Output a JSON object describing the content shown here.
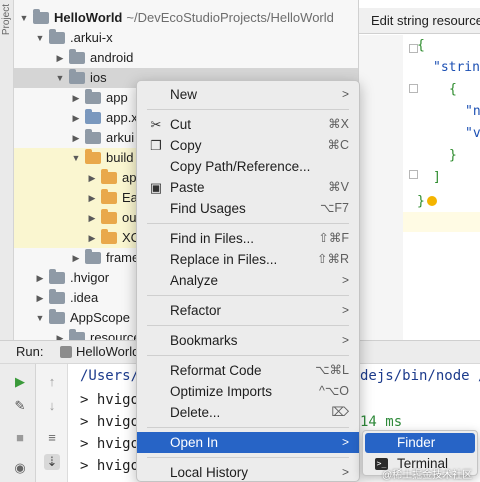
{
  "gutter_label": "Project",
  "tree": {
    "root_name": "HelloWorld",
    "root_path": "~/DevEcoStudioProjects/HelloWorld",
    "items": [
      {
        "label": "HelloWorld"
      },
      {
        "label": ".arkui-x"
      },
      {
        "label": "android"
      },
      {
        "label": "ios"
      },
      {
        "label": "app"
      },
      {
        "label": "app.x"
      },
      {
        "label": "arkui"
      },
      {
        "label": "build"
      },
      {
        "label": "ap"
      },
      {
        "label": "Ea"
      },
      {
        "label": "ou"
      },
      {
        "label": "XC"
      },
      {
        "label": "frame"
      },
      {
        "label": ".hvigor"
      },
      {
        "label": ".idea"
      },
      {
        "label": "AppScope"
      },
      {
        "label": "resources"
      }
    ]
  },
  "editor": {
    "tab_title": "Edit string resources",
    "line_1": "{",
    "line_2": "\"strin",
    "line_3": "{",
    "line_4": "\"n",
    "line_5": "\"v",
    "line_6": "}",
    "line_7": "]",
    "line_8": "}"
  },
  "run": {
    "label": "Run:",
    "tab": "HelloWorld"
  },
  "console": {
    "line_1": "/Users/",
    "line_1_tail": "dejs/bin/node /",
    "line_2": "> hvigo",
    "line_3": "> hvigo",
    "line_3_tail": "14 ms",
    "line_4": "> hvigo",
    "line_5": "> hvigo"
  },
  "menu": {
    "new": "New",
    "cut": "Cut",
    "cut_key": "⌘X",
    "copy": "Copy",
    "copy_key": "⌘C",
    "copy_path": "Copy Path/Reference...",
    "paste": "Paste",
    "paste_key": "⌘V",
    "find_usages": "Find Usages",
    "find_usages_key": "⌥F7",
    "find_in_files": "Find in Files...",
    "find_in_files_key": "⇧⌘F",
    "replace_in_files": "Replace in Files...",
    "replace_in_files_key": "⇧⌘R",
    "analyze": "Analyze",
    "refactor": "Refactor",
    "bookmarks": "Bookmarks",
    "reformat_code": "Reformat Code",
    "reformat_code_key": "⌥⌘L",
    "optimize_imports": "Optimize Imports",
    "optimize_imports_key": "^⌥O",
    "delete": "Delete...",
    "delete_key": "⌦",
    "open_in": "Open In",
    "local_history": "Local History"
  },
  "submenu": {
    "finder": "Finder",
    "terminal": "Terminal"
  },
  "watermark": "@稀土掘金技术社区",
  "colors": {
    "selection": "#2764c6",
    "folder_orange": "#e9a84b",
    "json_string": "#1b4fb3"
  }
}
